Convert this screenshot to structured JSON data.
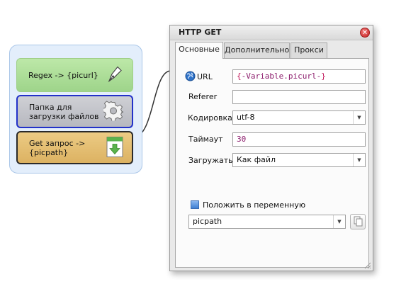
{
  "workflow": {
    "blocks": [
      {
        "label": "Regex -> {picurl}",
        "icon": "pen-icon",
        "color": "#a9dc92"
      },
      {
        "label": "Папка для загрузки файлов",
        "icon": "gear-icon",
        "color": "#c4c5ca"
      },
      {
        "label": "Get запрос -> {picpath}",
        "icon": "download-icon",
        "color": "#e3bd70"
      }
    ]
  },
  "panel": {
    "title": "HTTP GET",
    "close_icon": "close-icon",
    "tabs": [
      {
        "label": "Основные",
        "active": true
      },
      {
        "label": "Дополнительно",
        "active": false
      },
      {
        "label": "Прокси",
        "active": false
      }
    ],
    "fields": {
      "url": {
        "label": "URL",
        "value": "{-Variable.picurl-}",
        "icon": "globe-icon"
      },
      "referer": {
        "label": "Referer",
        "value": ""
      },
      "encoding": {
        "label": "Кодировка",
        "value": "utf-8"
      },
      "timeout": {
        "label": "Таймаут",
        "value": "30"
      },
      "load": {
        "label": "Загружать",
        "value": "Как файл"
      }
    },
    "put_in_variable": {
      "label": "Положить в переменную",
      "checked": true
    },
    "variable_select": {
      "value": "picpath"
    },
    "copy_icon": "copy-icon"
  },
  "colors": {
    "url_value": "#8b1a6b",
    "url_brace": "#c2185b",
    "timeout_value": "#8b1a6b",
    "selected_border": "#2231c9"
  }
}
